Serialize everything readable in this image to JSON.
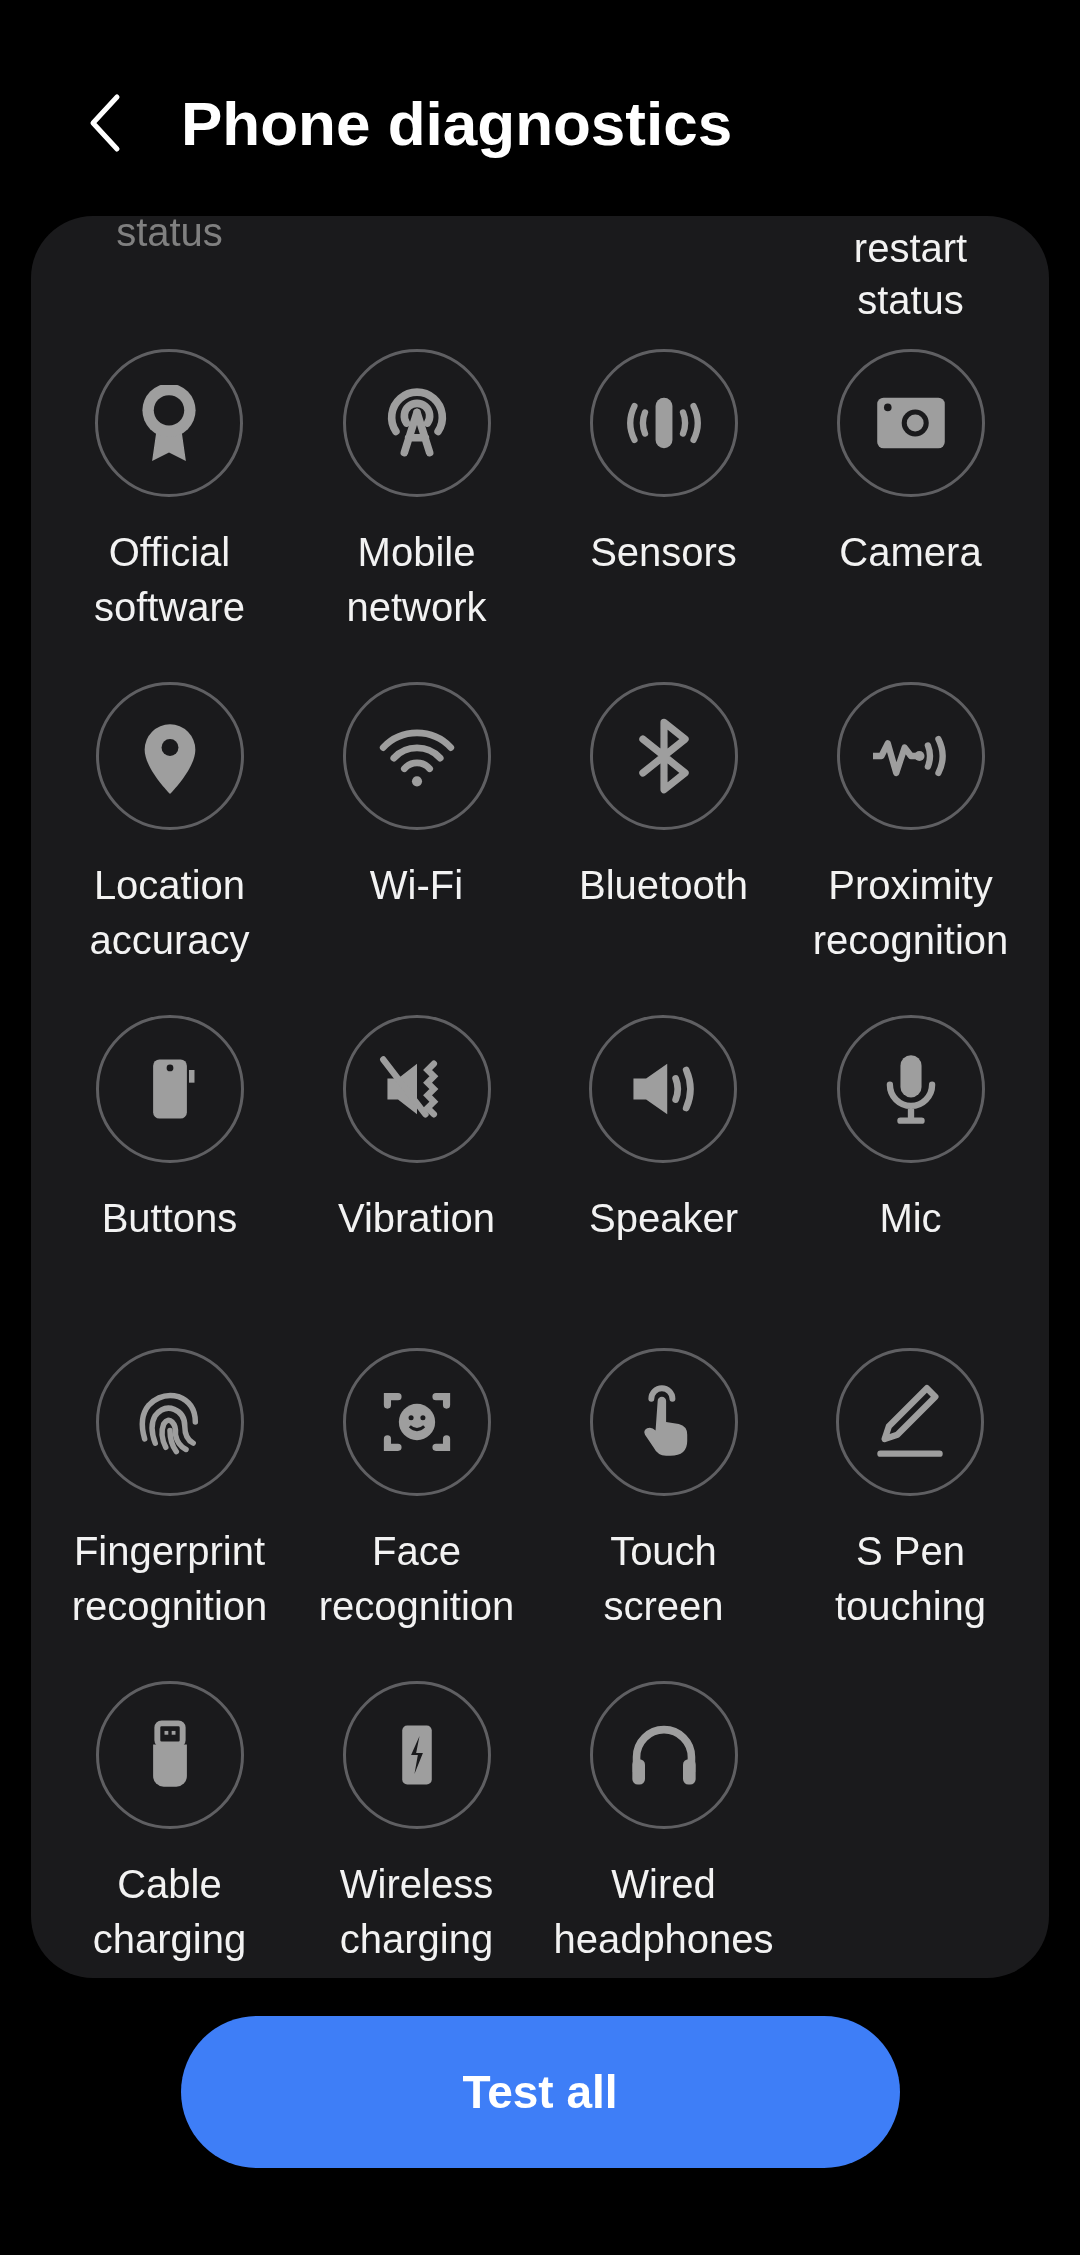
{
  "header": {
    "title": "Phone diagnostics"
  },
  "partial_row": [
    {
      "label": "status",
      "dimmed": true
    },
    {
      "label": "restart\nstatus",
      "dimmed": false
    }
  ],
  "tests": [
    {
      "label": "Official\nsoftware"
    },
    {
      "label": "Mobile\nnetwork"
    },
    {
      "label": "Sensors"
    },
    {
      "label": "Camera"
    },
    {
      "label": "Location\naccuracy"
    },
    {
      "label": "Wi-Fi"
    },
    {
      "label": "Bluetooth"
    },
    {
      "label": "Proximity\nrecognition"
    },
    {
      "label": "Buttons"
    },
    {
      "label": "Vibration"
    },
    {
      "label": "Speaker"
    },
    {
      "label": "Mic"
    },
    {
      "label": "Fingerprint\nrecognition"
    },
    {
      "label": "Face\nrecognition"
    },
    {
      "label": "Touch\nscreen"
    },
    {
      "label": "S Pen\ntouching"
    },
    {
      "label": "Cable\ncharging"
    },
    {
      "label": "Wireless\ncharging"
    },
    {
      "label": "Wired\nheadphones"
    }
  ],
  "action_button": {
    "label": "Test all"
  }
}
